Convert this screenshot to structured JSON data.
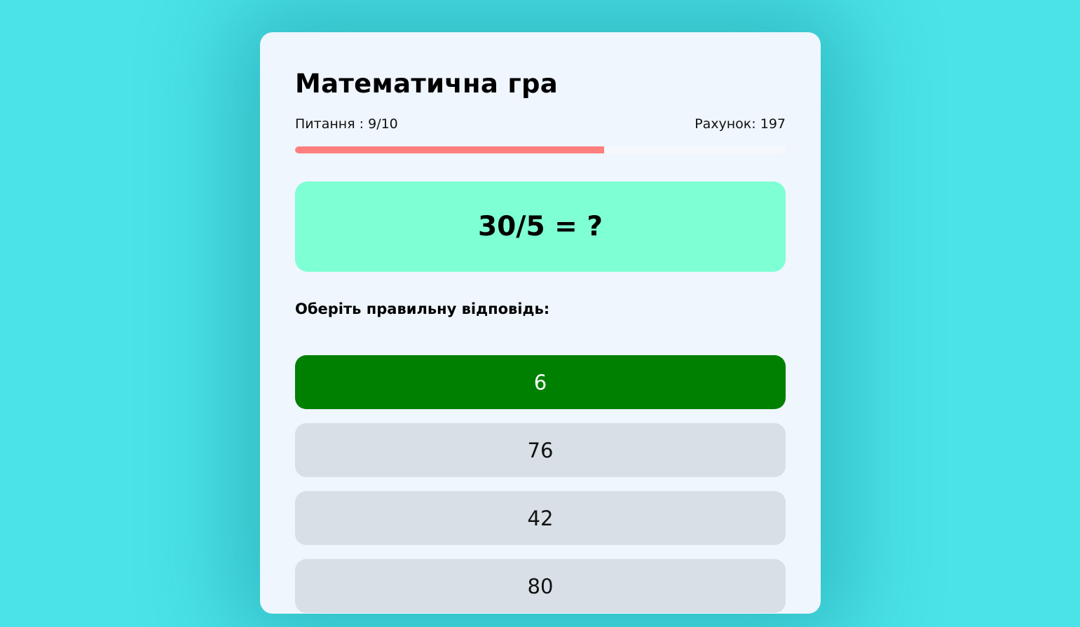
{
  "game": {
    "title": "Математична гра",
    "question_counter": "Питання : 9/10",
    "score": "Рахунок: 197",
    "progress_fraction": 0.63,
    "question": "30/5 = ?",
    "prompt": "Оберіть правильну відповідь:",
    "answers": [
      {
        "label": "6",
        "state": "correct"
      },
      {
        "label": "76",
        "state": "default"
      },
      {
        "label": "42",
        "state": "default"
      },
      {
        "label": "80",
        "state": "default"
      }
    ]
  },
  "colors": {
    "background": "#4ae3e8",
    "card": "#eff6fe",
    "progress_fill": "#ff7f7f",
    "question_box": "#7fffd4",
    "answer_correct": "#008000",
    "answer_default": "#d9dfe6"
  }
}
